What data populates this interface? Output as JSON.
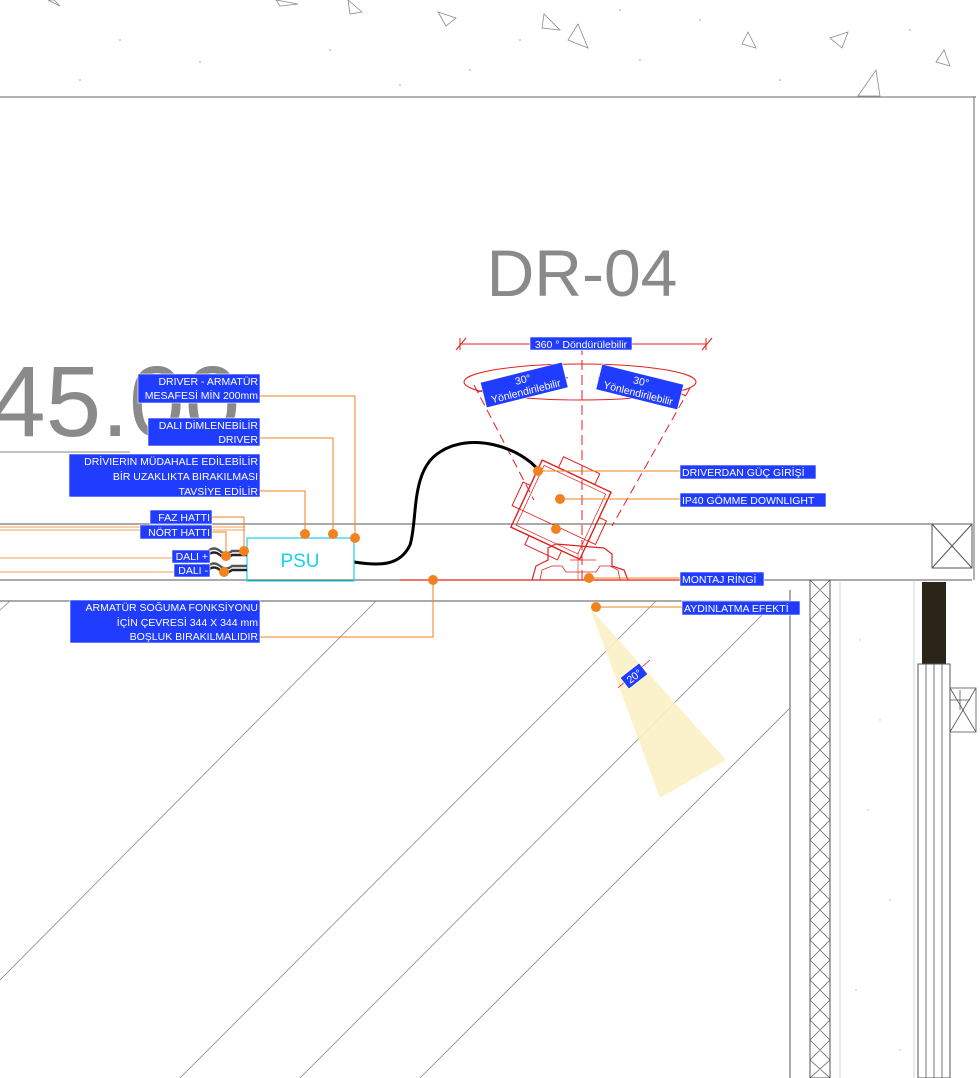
{
  "drawing": {
    "code": "DR-04",
    "elevation": "45.00",
    "psu_label": "PSU",
    "rotation_label": "360 ° Döndürülebilir",
    "tilt_left": {
      "value": "30°",
      "text": "Yönlendirilebilir"
    },
    "tilt_right": {
      "value": "30°",
      "text": "Yönlendirilebilir"
    },
    "beam_angle": "20°"
  },
  "left_labels": {
    "driver_distance": [
      "DRIVER - ARMATÜR",
      "MESAFESİ MİN 200mm"
    ],
    "dali_dimmable": [
      "DALI DİMLENEBİLİR",
      "DRIVER"
    ],
    "driver_access": [
      "DRİVIERIN MÜDAHALE EDİLEBİLİR",
      "BİR UZAKLIKTA BIRAKILMASI",
      "TAVSİYE EDİLİR"
    ],
    "faz": "FAZ HATTI",
    "nort": "NÖRT HATTI",
    "dali_plus": "DALI +",
    "dali_minus": "DALI -",
    "cooling": [
      "ARMATÜR SOĞUMA FONKSİYONU",
      "İÇİN ÇEVRESİ 344 X 344 mm",
      "BOŞLUK BIRAKILMALIDIR"
    ]
  },
  "right_labels": {
    "power_input": "DRIVERDAN GÜÇ GİRİŞİ",
    "downlight": "IP40 GÖMME DOWNLIGHT",
    "mount_ring": "MONTAJ RİNGİ",
    "light_effect": "AYDINLATMA EFEKTİ"
  }
}
